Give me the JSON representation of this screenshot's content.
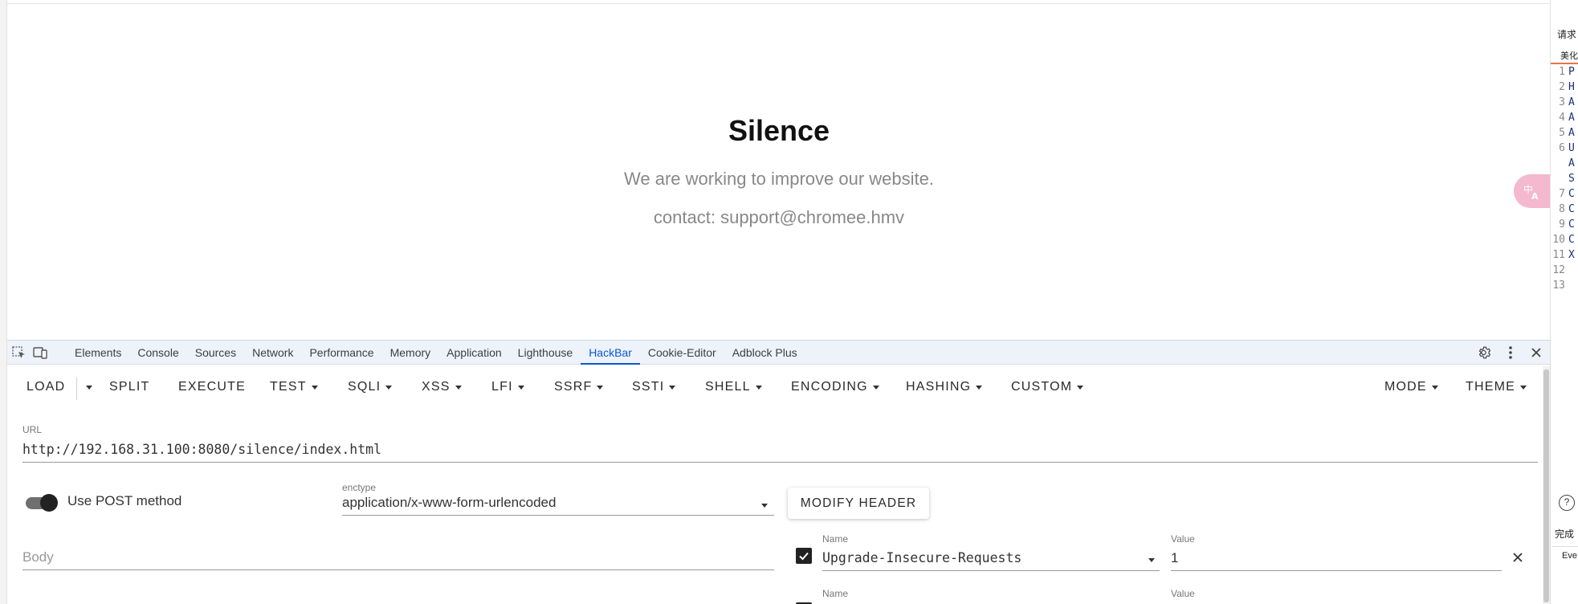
{
  "page": {
    "title": "Silence",
    "subtitle": "We are working to improve our website.",
    "contact": "contact: support@chromee.hmv"
  },
  "right_panel": {
    "title": "请求",
    "tab": "美化",
    "lines": [
      {
        "n": "1",
        "t": "P"
      },
      {
        "n": "2",
        "t": "H"
      },
      {
        "n": "3",
        "t": "A"
      },
      {
        "n": "4",
        "t": "A"
      },
      {
        "n": "5",
        "t": "A"
      },
      {
        "n": "6",
        "t": "U"
      },
      {
        "n": "",
        "t": "A"
      },
      {
        "n": "",
        "t": "S"
      },
      {
        "n": "7",
        "t": "C"
      },
      {
        "n": "8",
        "t": "C"
      },
      {
        "n": "9",
        "t": "C"
      },
      {
        "n": "10",
        "t": "C"
      },
      {
        "n": "11",
        "t": "X"
      },
      {
        "n": "12",
        "t": ""
      },
      {
        "n": "13",
        "t": ""
      }
    ],
    "help_icon": "?",
    "done_label": "完成",
    "events_label": "Eve"
  },
  "devtools": {
    "tabs": [
      "Elements",
      "Console",
      "Sources",
      "Network",
      "Performance",
      "Memory",
      "Application",
      "Lighthouse",
      "HackBar",
      "Cookie-Editor",
      "Adblock Plus"
    ],
    "active_tab": "HackBar"
  },
  "hackbar": {
    "toolbar": {
      "load": "LOAD",
      "split": "SPLIT",
      "execute": "EXECUTE",
      "test": "TEST",
      "sqli": "SQLI",
      "xss": "XSS",
      "lfi": "LFI",
      "ssrf": "SSRF",
      "ssti": "SSTI",
      "shell": "SHELL",
      "encoding": "ENCODING",
      "hashing": "HASHING",
      "custom": "CUSTOM",
      "mode": "MODE",
      "theme": "THEME"
    },
    "url_label": "URL",
    "url_value": "http://192.168.31.100:8080/silence/index.html",
    "post_toggle_label": "Use POST method",
    "post_enabled": true,
    "enctype_label": "enctype",
    "enctype_value": "application/x-www-form-urlencoded",
    "modify_header_label": "MODIFY HEADER",
    "body_placeholder": "Body",
    "headers": [
      {
        "name_label": "Name",
        "name": "Upgrade-Insecure-Requests",
        "value_label": "Value",
        "value": "1",
        "enabled": true
      },
      {
        "name_label": "Name",
        "name": "",
        "value_label": "Value",
        "value": "",
        "enabled": true
      }
    ]
  },
  "colors": {
    "active_tab": "#0b57d0",
    "tabbar_bg": "#eef3fb",
    "translate_bubble": "#f4b8cf",
    "panel_accent": "#e8744a"
  }
}
